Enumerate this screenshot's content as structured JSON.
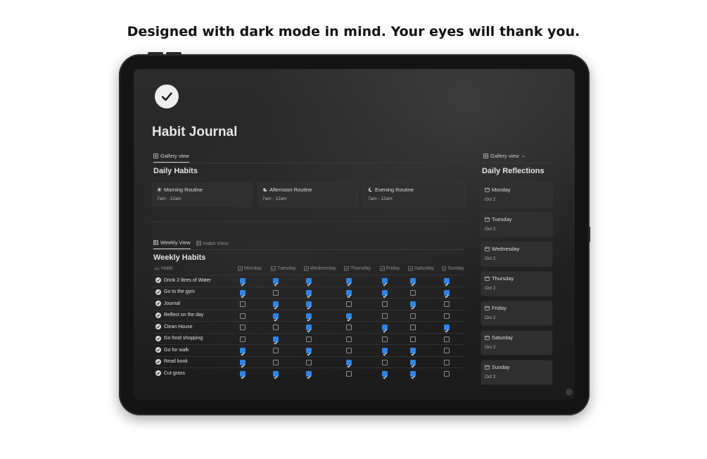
{
  "headline": "Designed with dark mode in mind. Your eyes will thank you.",
  "app": {
    "title": "Habit Journal",
    "logo_icon": "check-circle-icon"
  },
  "daily_habits": {
    "tab_label": "Gallery view",
    "title": "Daily Habits",
    "cards": [
      {
        "title": "Morning Routine",
        "time": "7am - 12am",
        "icon": "sun-icon"
      },
      {
        "title": "Afternoon Routine",
        "time": "7am - 12am",
        "icon": "cloud-icon"
      },
      {
        "title": "Evening Routine",
        "time": "7am - 12am",
        "icon": "moon-icon"
      }
    ]
  },
  "weekly": {
    "tabs": [
      "Weekly View",
      "Habit View"
    ],
    "title": "Weekly Habits",
    "habit_col": "Habit",
    "days": [
      "Monday",
      "Tuesday",
      "Wednesday",
      "Thursday",
      "Friday",
      "Saturday",
      "Sunday"
    ],
    "rows": [
      {
        "name": "Drink 2 litres of Water",
        "checks": [
          true,
          true,
          true,
          true,
          true,
          true,
          true
        ]
      },
      {
        "name": "Go to the gym",
        "checks": [
          true,
          false,
          true,
          true,
          true,
          false,
          true
        ]
      },
      {
        "name": "Journal",
        "checks": [
          false,
          true,
          true,
          false,
          false,
          true,
          false
        ]
      },
      {
        "name": "Reflect on the day",
        "checks": [
          false,
          true,
          true,
          true,
          false,
          false,
          false
        ]
      },
      {
        "name": "Clean House",
        "checks": [
          false,
          false,
          true,
          false,
          true,
          false,
          true
        ]
      },
      {
        "name": "Go food shopping",
        "checks": [
          false,
          true,
          false,
          false,
          false,
          false,
          false
        ]
      },
      {
        "name": "Go for walk",
        "checks": [
          true,
          false,
          true,
          false,
          true,
          true,
          false
        ]
      },
      {
        "name": "Read book",
        "checks": [
          true,
          false,
          false,
          true,
          false,
          true,
          false
        ]
      },
      {
        "name": "Cut grass",
        "checks": [
          true,
          true,
          true,
          false,
          true,
          true,
          false
        ]
      }
    ]
  },
  "reflections": {
    "tab_label": "Gallery view",
    "title": "Daily Reflections",
    "items": [
      {
        "day": "Monday",
        "date": "Oct 2"
      },
      {
        "day": "Tuesday",
        "date": "Oct 2"
      },
      {
        "day": "Wednesday",
        "date": "Oct 2"
      },
      {
        "day": "Thursday",
        "date": "Oct 2"
      },
      {
        "day": "Friday",
        "date": "Oct 2"
      },
      {
        "day": "Saturday",
        "date": "Oct 2"
      },
      {
        "day": "Sunday",
        "date": "Oct 2"
      }
    ]
  },
  "colors": {
    "checkbox_on": "#2e84e8",
    "screen_bg": "#232323",
    "card_bg": "#2f2f2f"
  }
}
